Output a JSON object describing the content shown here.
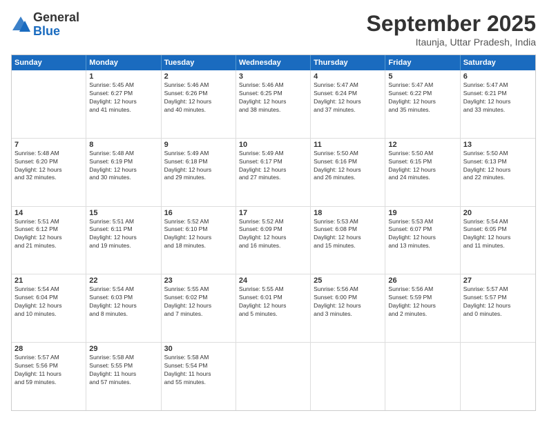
{
  "header": {
    "logo_general": "General",
    "logo_blue": "Blue",
    "month_title": "September 2025",
    "location": "Itaunja, Uttar Pradesh, India"
  },
  "calendar": {
    "days_of_week": [
      "Sunday",
      "Monday",
      "Tuesday",
      "Wednesday",
      "Thursday",
      "Friday",
      "Saturday"
    ],
    "rows": [
      [
        {
          "day": "",
          "lines": []
        },
        {
          "day": "1",
          "lines": [
            "Sunrise: 5:45 AM",
            "Sunset: 6:27 PM",
            "Daylight: 12 hours",
            "and 41 minutes."
          ]
        },
        {
          "day": "2",
          "lines": [
            "Sunrise: 5:46 AM",
            "Sunset: 6:26 PM",
            "Daylight: 12 hours",
            "and 40 minutes."
          ]
        },
        {
          "day": "3",
          "lines": [
            "Sunrise: 5:46 AM",
            "Sunset: 6:25 PM",
            "Daylight: 12 hours",
            "and 38 minutes."
          ]
        },
        {
          "day": "4",
          "lines": [
            "Sunrise: 5:47 AM",
            "Sunset: 6:24 PM",
            "Daylight: 12 hours",
            "and 37 minutes."
          ]
        },
        {
          "day": "5",
          "lines": [
            "Sunrise: 5:47 AM",
            "Sunset: 6:22 PM",
            "Daylight: 12 hours",
            "and 35 minutes."
          ]
        },
        {
          "day": "6",
          "lines": [
            "Sunrise: 5:47 AM",
            "Sunset: 6:21 PM",
            "Daylight: 12 hours",
            "and 33 minutes."
          ]
        }
      ],
      [
        {
          "day": "7",
          "lines": [
            "Sunrise: 5:48 AM",
            "Sunset: 6:20 PM",
            "Daylight: 12 hours",
            "and 32 minutes."
          ]
        },
        {
          "day": "8",
          "lines": [
            "Sunrise: 5:48 AM",
            "Sunset: 6:19 PM",
            "Daylight: 12 hours",
            "and 30 minutes."
          ]
        },
        {
          "day": "9",
          "lines": [
            "Sunrise: 5:49 AM",
            "Sunset: 6:18 PM",
            "Daylight: 12 hours",
            "and 29 minutes."
          ]
        },
        {
          "day": "10",
          "lines": [
            "Sunrise: 5:49 AM",
            "Sunset: 6:17 PM",
            "Daylight: 12 hours",
            "and 27 minutes."
          ]
        },
        {
          "day": "11",
          "lines": [
            "Sunrise: 5:50 AM",
            "Sunset: 6:16 PM",
            "Daylight: 12 hours",
            "and 26 minutes."
          ]
        },
        {
          "day": "12",
          "lines": [
            "Sunrise: 5:50 AM",
            "Sunset: 6:15 PM",
            "Daylight: 12 hours",
            "and 24 minutes."
          ]
        },
        {
          "day": "13",
          "lines": [
            "Sunrise: 5:50 AM",
            "Sunset: 6:13 PM",
            "Daylight: 12 hours",
            "and 22 minutes."
          ]
        }
      ],
      [
        {
          "day": "14",
          "lines": [
            "Sunrise: 5:51 AM",
            "Sunset: 6:12 PM",
            "Daylight: 12 hours",
            "and 21 minutes."
          ]
        },
        {
          "day": "15",
          "lines": [
            "Sunrise: 5:51 AM",
            "Sunset: 6:11 PM",
            "Daylight: 12 hours",
            "and 19 minutes."
          ]
        },
        {
          "day": "16",
          "lines": [
            "Sunrise: 5:52 AM",
            "Sunset: 6:10 PM",
            "Daylight: 12 hours",
            "and 18 minutes."
          ]
        },
        {
          "day": "17",
          "lines": [
            "Sunrise: 5:52 AM",
            "Sunset: 6:09 PM",
            "Daylight: 12 hours",
            "and 16 minutes."
          ]
        },
        {
          "day": "18",
          "lines": [
            "Sunrise: 5:53 AM",
            "Sunset: 6:08 PM",
            "Daylight: 12 hours",
            "and 15 minutes."
          ]
        },
        {
          "day": "19",
          "lines": [
            "Sunrise: 5:53 AM",
            "Sunset: 6:07 PM",
            "Daylight: 12 hours",
            "and 13 minutes."
          ]
        },
        {
          "day": "20",
          "lines": [
            "Sunrise: 5:54 AM",
            "Sunset: 6:05 PM",
            "Daylight: 12 hours",
            "and 11 minutes."
          ]
        }
      ],
      [
        {
          "day": "21",
          "lines": [
            "Sunrise: 5:54 AM",
            "Sunset: 6:04 PM",
            "Daylight: 12 hours",
            "and 10 minutes."
          ]
        },
        {
          "day": "22",
          "lines": [
            "Sunrise: 5:54 AM",
            "Sunset: 6:03 PM",
            "Daylight: 12 hours",
            "and 8 minutes."
          ]
        },
        {
          "day": "23",
          "lines": [
            "Sunrise: 5:55 AM",
            "Sunset: 6:02 PM",
            "Daylight: 12 hours",
            "and 7 minutes."
          ]
        },
        {
          "day": "24",
          "lines": [
            "Sunrise: 5:55 AM",
            "Sunset: 6:01 PM",
            "Daylight: 12 hours",
            "and 5 minutes."
          ]
        },
        {
          "day": "25",
          "lines": [
            "Sunrise: 5:56 AM",
            "Sunset: 6:00 PM",
            "Daylight: 12 hours",
            "and 3 minutes."
          ]
        },
        {
          "day": "26",
          "lines": [
            "Sunrise: 5:56 AM",
            "Sunset: 5:59 PM",
            "Daylight: 12 hours",
            "and 2 minutes."
          ]
        },
        {
          "day": "27",
          "lines": [
            "Sunrise: 5:57 AM",
            "Sunset: 5:57 PM",
            "Daylight: 12 hours",
            "and 0 minutes."
          ]
        }
      ],
      [
        {
          "day": "28",
          "lines": [
            "Sunrise: 5:57 AM",
            "Sunset: 5:56 PM",
            "Daylight: 11 hours",
            "and 59 minutes."
          ]
        },
        {
          "day": "29",
          "lines": [
            "Sunrise: 5:58 AM",
            "Sunset: 5:55 PM",
            "Daylight: 11 hours",
            "and 57 minutes."
          ]
        },
        {
          "day": "30",
          "lines": [
            "Sunrise: 5:58 AM",
            "Sunset: 5:54 PM",
            "Daylight: 11 hours",
            "and 55 minutes."
          ]
        },
        {
          "day": "",
          "lines": []
        },
        {
          "day": "",
          "lines": []
        },
        {
          "day": "",
          "lines": []
        },
        {
          "day": "",
          "lines": []
        }
      ]
    ]
  }
}
